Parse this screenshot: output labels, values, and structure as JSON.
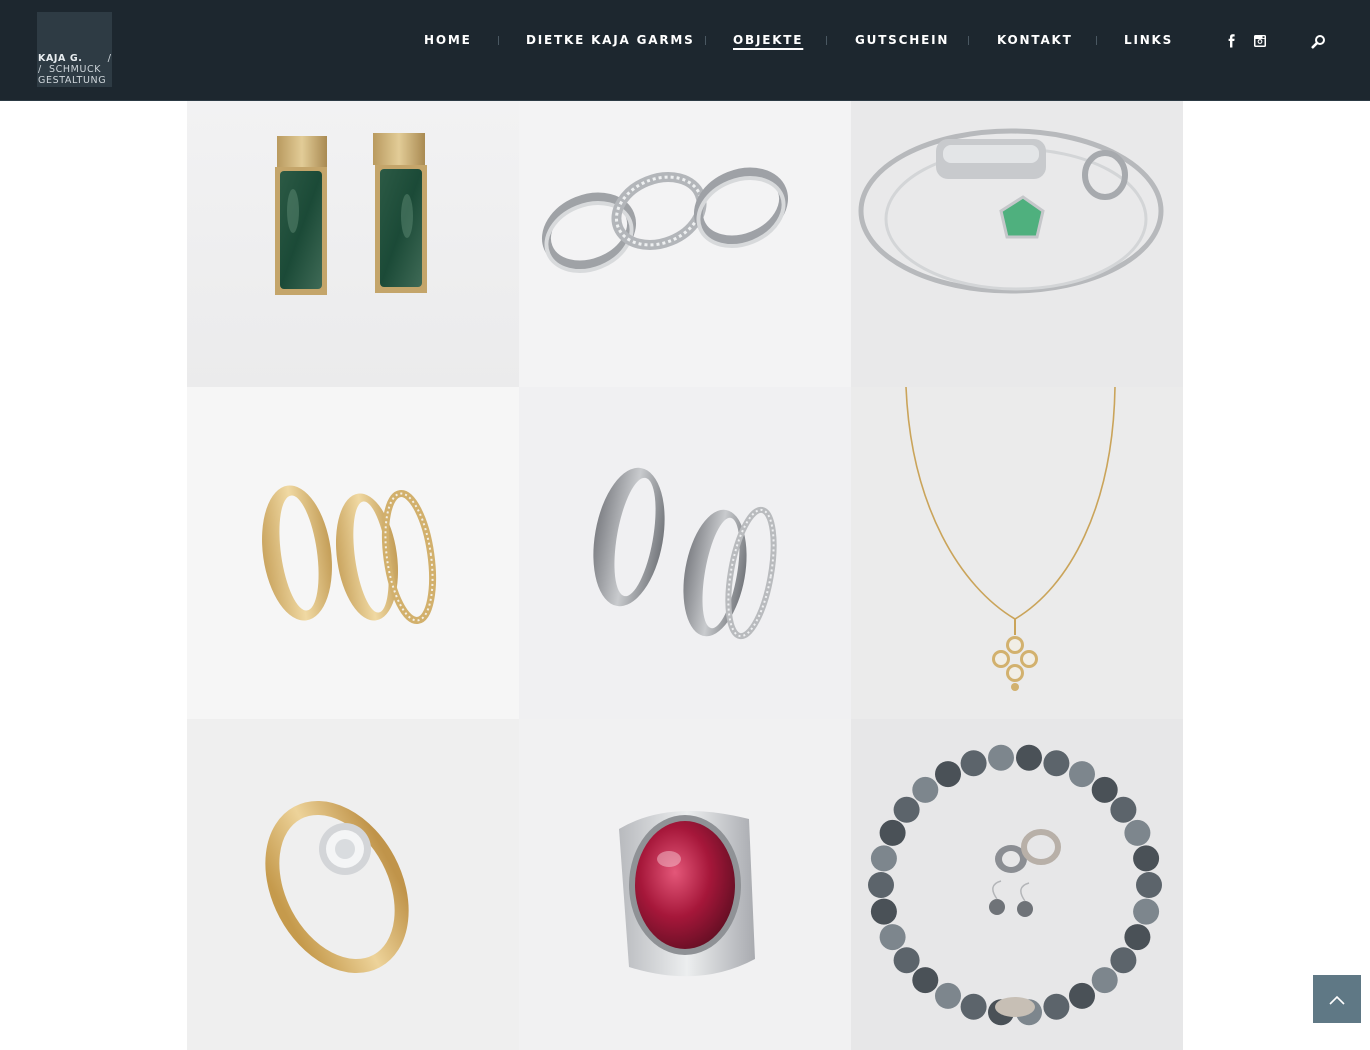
{
  "logo": {
    "line1": "KAJA G.",
    "line1_slash": "/",
    "line2": "/  SCHMUCK",
    "line3": "GESTALTUNG"
  },
  "nav": {
    "items": [
      {
        "label": "HOME",
        "active": false
      },
      {
        "label": "DIETKE KAJA GARMS",
        "active": false
      },
      {
        "label": "OBJEKTE",
        "active": true
      },
      {
        "label": "GUTSCHEIN",
        "active": false
      },
      {
        "label": "KONTAKT",
        "active": false
      },
      {
        "label": "LINKS",
        "active": false
      }
    ],
    "social": [
      "facebook-icon",
      "instagram-icon"
    ],
    "search_icon": "search-icon"
  },
  "gallery": {
    "items": [
      {
        "subject": "gold earrings with green tourmaline"
      },
      {
        "subject": "three diamond eternity rings"
      },
      {
        "subject": "silver bangle and rings with green stone"
      },
      {
        "subject": "gold wedding rings with diamond band"
      },
      {
        "subject": "platinum wedding rings with diamonds"
      },
      {
        "subject": "gold necklace with pearl pendant"
      },
      {
        "subject": "gold ring with solitaire diamond"
      },
      {
        "subject": "silver ring with red tourmaline cabochon"
      },
      {
        "subject": "tahitian pearl necklace with rings and earrings"
      }
    ]
  },
  "colors": {
    "header_bg": "#1d272f",
    "logo_bg": "#2e3b44",
    "accent_button": "#5f7885"
  },
  "back_to_top_icon": "chevron-up-icon"
}
